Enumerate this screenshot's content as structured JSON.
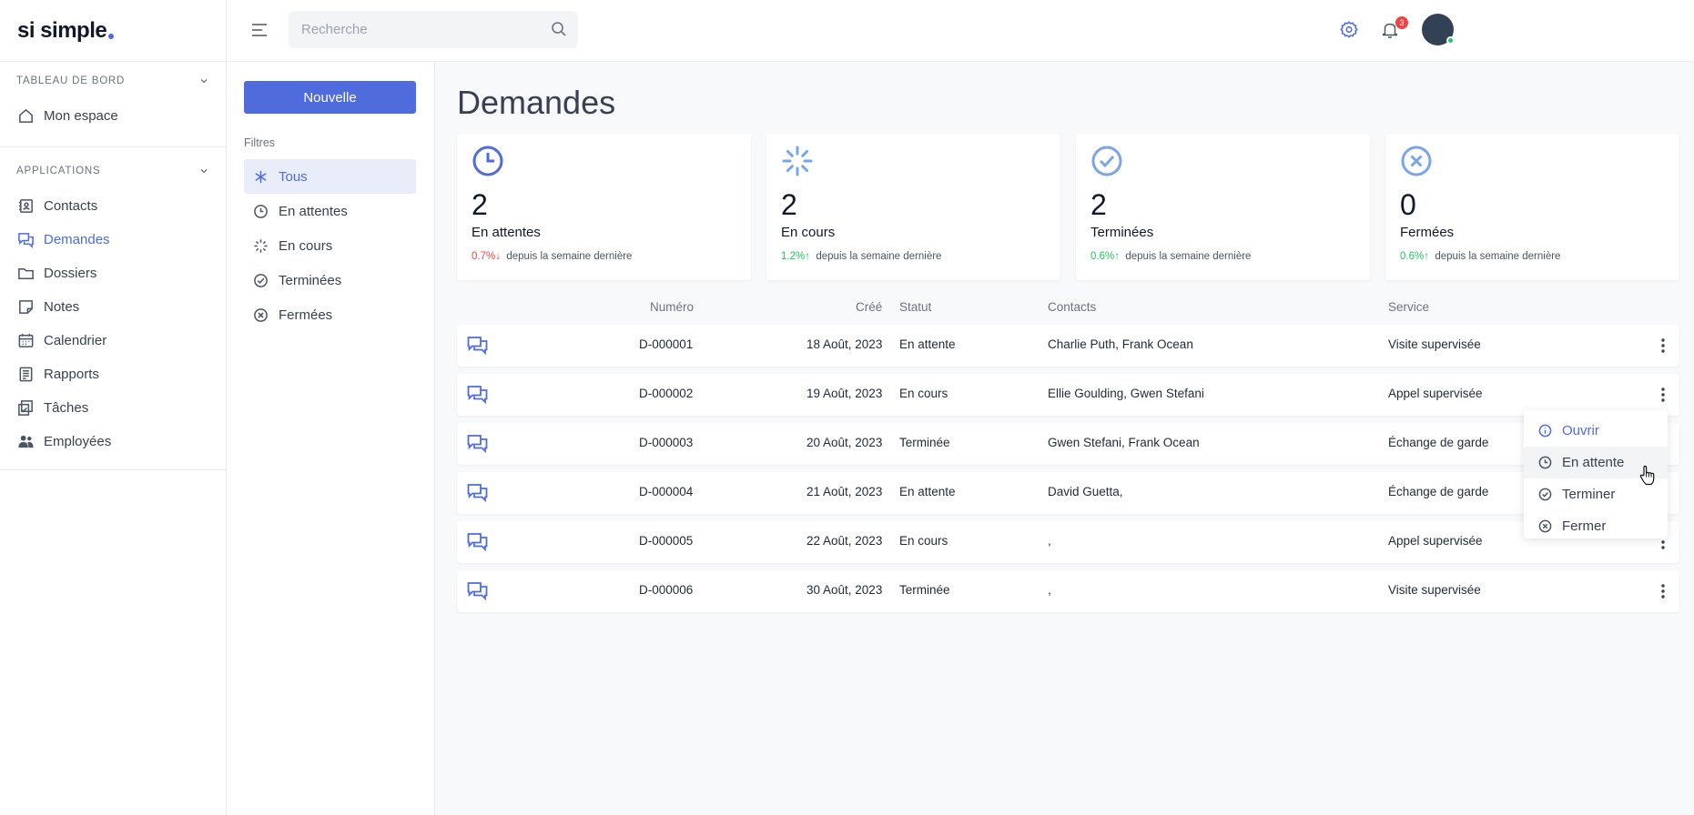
{
  "brand": {
    "name": "si simple",
    "dot_color": "#4f6bdc"
  },
  "sidebar": {
    "sections": [
      {
        "title": "TABLEAU DE BORD",
        "items": [
          {
            "label": "Mon espace",
            "icon": "home-icon"
          }
        ]
      },
      {
        "title": "APPLICATIONS",
        "items": [
          {
            "label": "Contacts",
            "icon": "contacts-icon"
          },
          {
            "label": "Demandes",
            "icon": "chat-icon",
            "active": true
          },
          {
            "label": "Dossiers",
            "icon": "folder-icon"
          },
          {
            "label": "Notes",
            "icon": "note-icon"
          },
          {
            "label": "Calendrier",
            "icon": "calendar-icon"
          },
          {
            "label": "Rapports",
            "icon": "report-icon"
          },
          {
            "label": "Tâches",
            "icon": "tasks-icon"
          },
          {
            "label": "Employées",
            "icon": "people-icon"
          }
        ]
      }
    ]
  },
  "topbar": {
    "search_placeholder": "Recherche",
    "notification_count": "3"
  },
  "filters": {
    "new_button": "Nouvelle",
    "label": "Filtres",
    "items": [
      {
        "label": "Tous",
        "icon": "asterisk-icon",
        "active": true
      },
      {
        "label": "En attentes",
        "icon": "clock-icon"
      },
      {
        "label": "En cours",
        "icon": "spinner-icon"
      },
      {
        "label": "Terminées",
        "icon": "check-circle-icon"
      },
      {
        "label": "Fermées",
        "icon": "x-circle-icon"
      }
    ]
  },
  "main": {
    "title": "Demandes",
    "stats": [
      {
        "value": "2",
        "label": "En attentes",
        "pct": "0.7%",
        "direction": "down",
        "suffix": "depuis la semaine dernière",
        "icon": "clock-icon"
      },
      {
        "value": "2",
        "label": "En cours",
        "pct": "1.2%",
        "direction": "up",
        "suffix": "depuis la semaine dernière",
        "icon": "spinner-icon"
      },
      {
        "value": "2",
        "label": "Terminées",
        "pct": "0.6%",
        "direction": "up",
        "suffix": "depuis la semaine dernière",
        "icon": "check-circle-icon"
      },
      {
        "value": "0",
        "label": "Fermées",
        "pct": "0.6%",
        "direction": "up",
        "suffix": "depuis la semaine dernière",
        "icon": "x-circle-icon"
      }
    ],
    "table": {
      "headers": {
        "numero": "Numéro",
        "cree": "Créé",
        "statut": "Statut",
        "contacts": "Contacts",
        "service": "Service"
      },
      "rows": [
        {
          "numero": "D-000001",
          "cree": "18 Août, 2023",
          "statut": "En attente",
          "contacts": "Charlie Puth, Frank Ocean",
          "service": "Visite supervisée"
        },
        {
          "numero": "D-000002",
          "cree": "19 Août, 2023",
          "statut": "En cours",
          "contacts": "Ellie Goulding, Gwen Stefani",
          "service": "Appel supervisée"
        },
        {
          "numero": "D-000003",
          "cree": "20 Août, 2023",
          "statut": "Terminée",
          "contacts": "Gwen Stefani, Frank Ocean",
          "service": "Échange de garde"
        },
        {
          "numero": "D-000004",
          "cree": "21 Août, 2023",
          "statut": "En attente",
          "contacts": "David Guetta,",
          "service": "Échange de garde"
        },
        {
          "numero": "D-000005",
          "cree": "22 Août, 2023",
          "statut": "En cours",
          "contacts": ",",
          "service": "Appel supervisée"
        },
        {
          "numero": "D-000006",
          "cree": "30 Août, 2023",
          "statut": "Terminée",
          "contacts": ",",
          "service": "Visite supervisée"
        }
      ]
    },
    "context_menu": {
      "items": [
        {
          "label": "Ouvrir",
          "icon": "info-icon"
        },
        {
          "label": "En attente",
          "icon": "clock-icon"
        },
        {
          "label": "Terminer",
          "icon": "check-circle-icon"
        },
        {
          "label": "Fermer",
          "icon": "x-circle-icon"
        }
      ]
    }
  },
  "colors": {
    "accent": "#4f6bdc",
    "up": "#22c55e",
    "down": "#ef4444"
  }
}
